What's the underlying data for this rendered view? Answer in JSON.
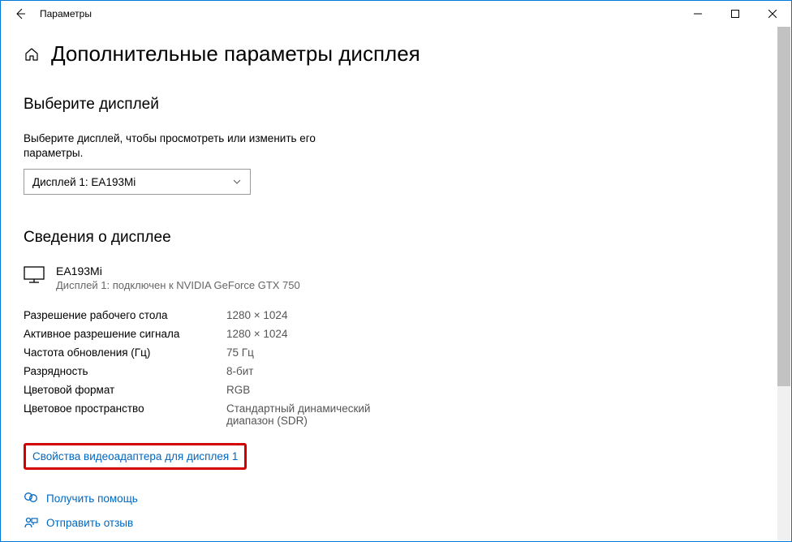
{
  "window": {
    "title": "Параметры"
  },
  "page": {
    "title": "Дополнительные параметры дисплея"
  },
  "select_display": {
    "heading": "Выберите дисплей",
    "instruction": "Выберите дисплей, чтобы просмотреть или изменить его параметры.",
    "selected": "Дисплей 1: EA193Mi"
  },
  "display_info": {
    "heading": "Сведения о дисплее",
    "name": "EA193Mi",
    "subtitle": "Дисплей 1: подключен к NVIDIA GeForce GTX 750",
    "rows": {
      "desktop_res_label": "Разрешение рабочего стола",
      "desktop_res_value": "1280 × 1024",
      "active_res_label": "Активное разрешение сигнала",
      "active_res_value": "1280 × 1024",
      "refresh_label": "Частота обновления (Гц)",
      "refresh_value": "75 Гц",
      "bitdepth_label": "Разрядность",
      "bitdepth_value": "8-бит",
      "color_fmt_label": "Цветовой формат",
      "color_fmt_value": "RGB",
      "color_space_label": "Цветовое пространство",
      "color_space_value": "Стандартный динамический диапазон (SDR)"
    },
    "adapter_link": "Свойства видеоадаптера для дисплея 1"
  },
  "footer": {
    "help": "Получить помощь",
    "feedback": "Отправить отзыв"
  }
}
